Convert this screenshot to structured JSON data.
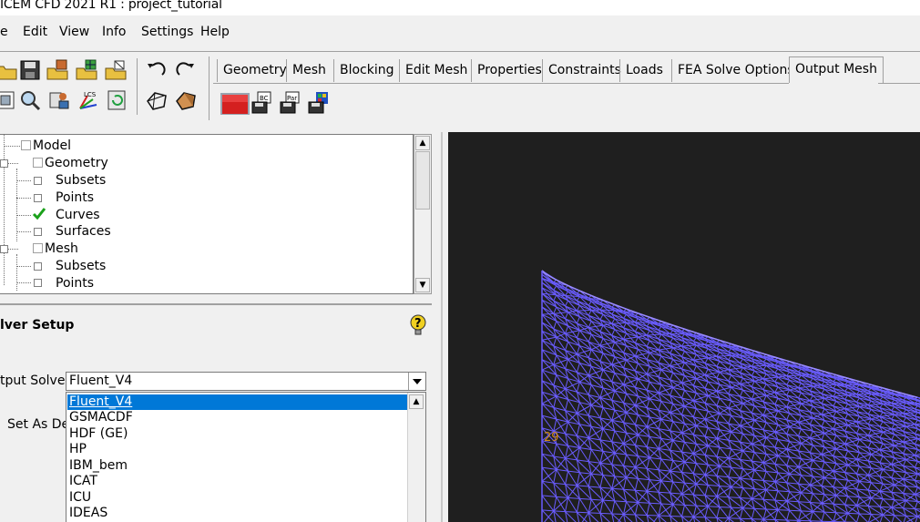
{
  "window": {
    "title": "ICEM CFD 2021 R1 : project_tutorial"
  },
  "menu": {
    "items": [
      "e",
      "Edit",
      "View",
      "Info",
      "Settings",
      "Help"
    ]
  },
  "tabs": {
    "items": [
      "Geometry",
      "Mesh",
      "Blocking",
      "Edit Mesh",
      "Properties",
      "Constraints",
      "Loads",
      "FEA Solve Options",
      "Output Mesh"
    ],
    "active": "Output Mesh"
  },
  "tree": {
    "nodes": [
      {
        "label": "Model"
      },
      {
        "label": "Geometry"
      },
      {
        "label": "Subsets"
      },
      {
        "label": "Points"
      },
      {
        "label": "Curves",
        "checked": true
      },
      {
        "label": "Surfaces"
      },
      {
        "label": "Mesh"
      },
      {
        "label": "Subsets"
      },
      {
        "label": "Points"
      }
    ]
  },
  "panel": {
    "title": "lver Setup",
    "output_solver_label": "tput Solver",
    "set_as_default_label": "Set As Def"
  },
  "solver_select": {
    "value": "Fluent_V4",
    "options": [
      "Fluent_V4",
      "GSMACDF",
      "HDF (GE)",
      "HP",
      "IBM_bem",
      "ICAT",
      "ICU",
      "IDEAS"
    ]
  },
  "viewport": {
    "node_label": "29"
  },
  "colors": {
    "mesh": "#6a5cff",
    "selection": "#0078d7",
    "viewport_bg": "#1f1f1f"
  }
}
